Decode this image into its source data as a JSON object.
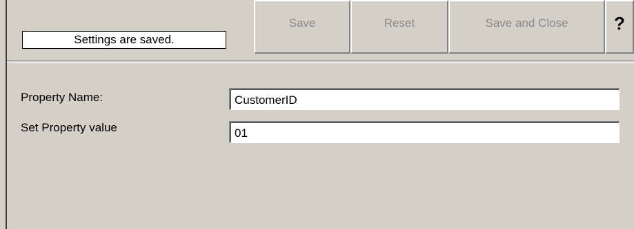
{
  "toolbar": {
    "status_text": "Settings are saved.",
    "save_label": "Save",
    "reset_label": "Reset",
    "save_close_label": "Save and Close",
    "help_label": "?"
  },
  "form": {
    "property_name_label": "Property Name:",
    "property_name_value": "CustomerID",
    "property_value_label": "Set Property value",
    "property_value_value": "01"
  },
  "colors": {
    "background": "#d4d0c8",
    "disabled_text": "#8a8a8a"
  }
}
